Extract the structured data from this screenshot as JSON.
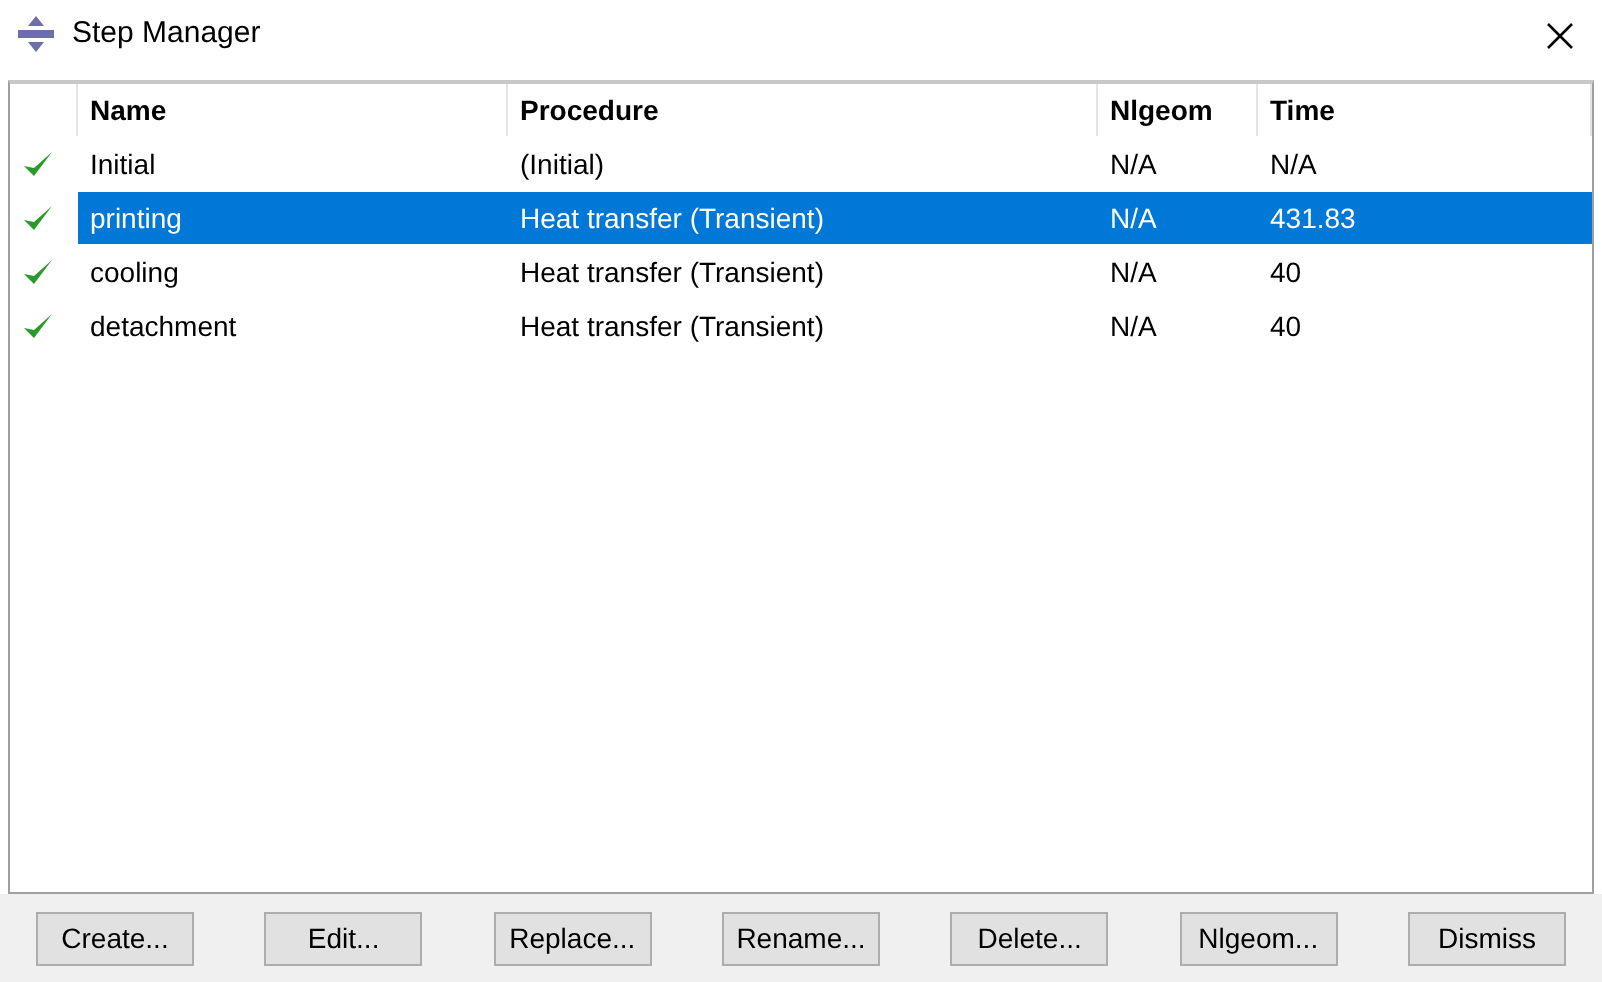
{
  "window": {
    "title": "Step Manager"
  },
  "table": {
    "columns": [
      "Name",
      "Procedure",
      "Nlgeom",
      "Time"
    ],
    "rows": [
      {
        "checked": true,
        "selected": false,
        "cells": [
          "Initial",
          "(Initial)",
          "N/A",
          "N/A"
        ]
      },
      {
        "checked": true,
        "selected": true,
        "cells": [
          "printing",
          "Heat transfer (Transient)",
          "N/A",
          "431.83"
        ]
      },
      {
        "checked": true,
        "selected": false,
        "cells": [
          "cooling",
          "Heat transfer (Transient)",
          "N/A",
          "40"
        ]
      },
      {
        "checked": true,
        "selected": false,
        "cells": [
          "detachment",
          "Heat transfer (Transient)",
          "N/A",
          "40"
        ]
      }
    ]
  },
  "buttons": [
    "Create...",
    "Edit...",
    "Replace...",
    "Rename...",
    "Delete...",
    "Nlgeom...",
    "Dismiss"
  ]
}
